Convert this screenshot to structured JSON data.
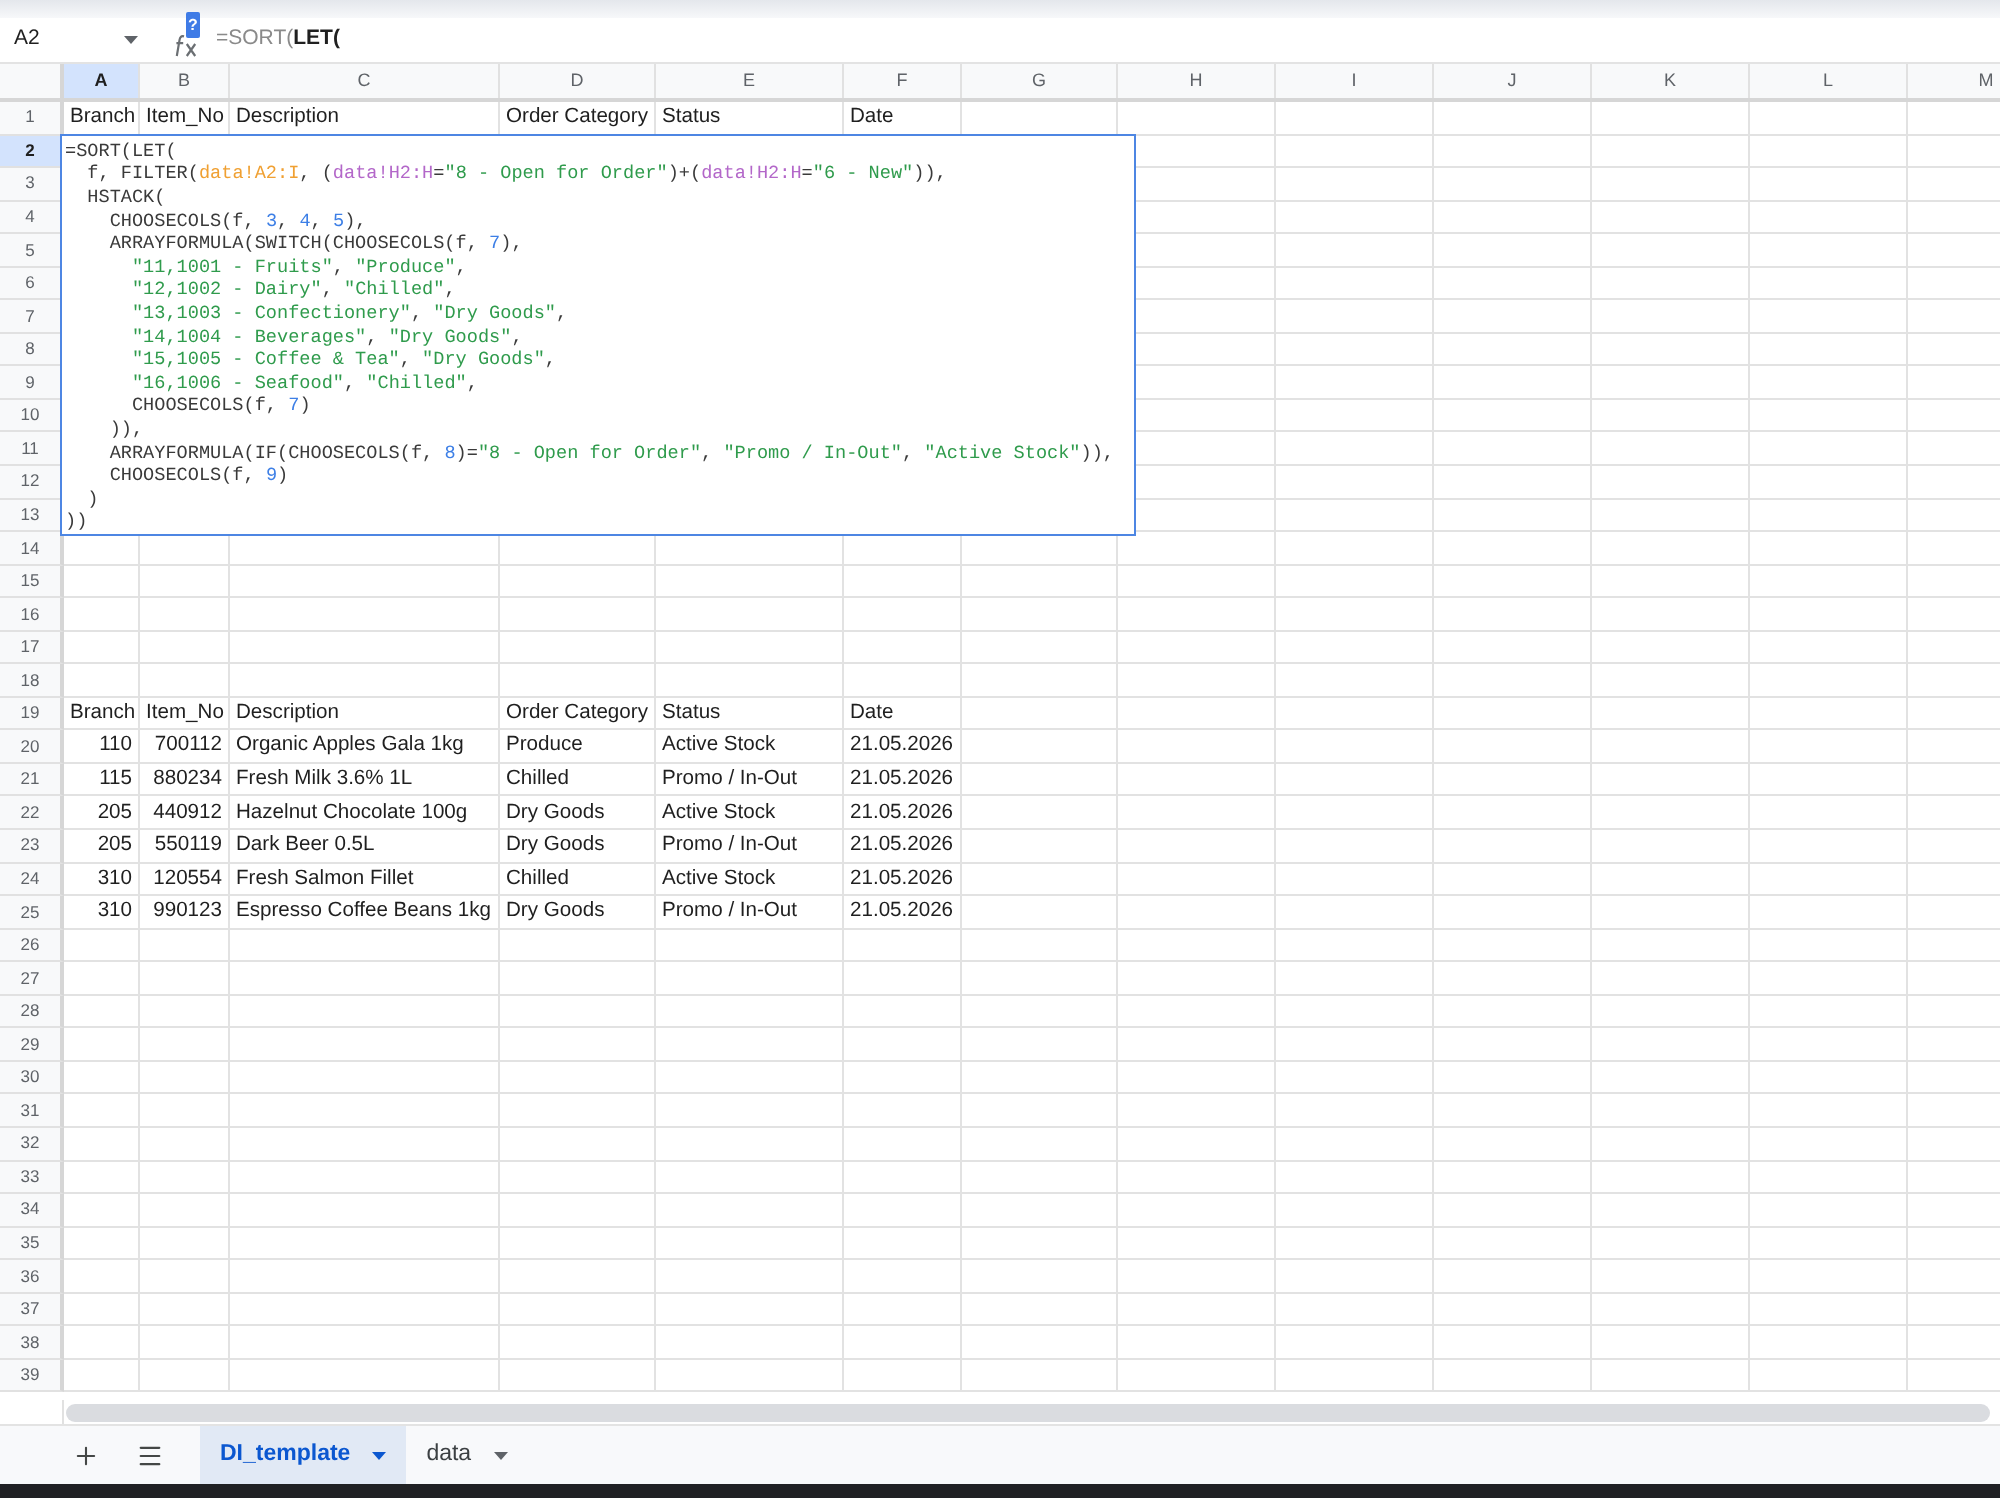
{
  "formula_bar": {
    "name_box": "A2",
    "help_badge": "?",
    "formula": "=SORT(**LET(**"
  },
  "columns": [
    {
      "label": "A",
      "selected": true
    },
    {
      "label": "B",
      "selected": false
    },
    {
      "label": "C",
      "selected": false
    },
    {
      "label": "D",
      "selected": false
    },
    {
      "label": "E",
      "selected": false
    },
    {
      "label": "F",
      "selected": false
    },
    {
      "label": "G",
      "selected": false
    },
    {
      "label": "H",
      "selected": false
    },
    {
      "label": "I",
      "selected": false
    },
    {
      "label": "J",
      "selected": false
    },
    {
      "label": "K",
      "selected": false
    },
    {
      "label": "L",
      "selected": false
    },
    {
      "label": "M",
      "selected": false
    }
  ],
  "rows": [
    {
      "number": "1",
      "selected": false,
      "cells": [
        {
          "text": "Branch",
          "kind": "text"
        },
        {
          "text": "Item_No",
          "kind": "text"
        },
        {
          "text": "Description",
          "kind": "text"
        },
        {
          "text": "Order Category",
          "kind": "text"
        },
        {
          "text": "Status",
          "kind": "text"
        },
        {
          "text": "Date",
          "kind": "text"
        }
      ]
    },
    {
      "number": "2",
      "selected": true
    },
    {
      "number": "3",
      "selected": false
    },
    {
      "number": "4",
      "selected": false
    },
    {
      "number": "5",
      "selected": false
    },
    {
      "number": "6",
      "selected": false
    },
    {
      "number": "7",
      "selected": false
    },
    {
      "number": "8",
      "selected": false
    },
    {
      "number": "9",
      "selected": false
    },
    {
      "number": "10",
      "selected": false
    },
    {
      "number": "11",
      "selected": false
    },
    {
      "number": "12",
      "selected": false
    },
    {
      "number": "13",
      "selected": false
    },
    {
      "number": "14",
      "selected": false
    },
    {
      "number": "15",
      "selected": false
    },
    {
      "number": "16",
      "selected": false
    },
    {
      "number": "17",
      "selected": false
    },
    {
      "number": "18",
      "selected": false
    },
    {
      "number": "19",
      "selected": false,
      "cells": [
        {
          "text": "Branch",
          "kind": "text"
        },
        {
          "text": "Item_No",
          "kind": "text"
        },
        {
          "text": "Description",
          "kind": "text"
        },
        {
          "text": "Order Category",
          "kind": "text"
        },
        {
          "text": "Status",
          "kind": "text"
        },
        {
          "text": "Date",
          "kind": "text"
        }
      ]
    },
    {
      "number": "20",
      "selected": false,
      "cells": [
        {
          "text": "110",
          "kind": "number"
        },
        {
          "text": "700112",
          "kind": "number"
        },
        {
          "text": "Organic Apples Gala 1kg",
          "kind": "text"
        },
        {
          "text": "Produce",
          "kind": "text"
        },
        {
          "text": "Active Stock",
          "kind": "text"
        },
        {
          "text": "21.05.2026",
          "kind": "text"
        }
      ]
    },
    {
      "number": "21",
      "selected": false,
      "cells": [
        {
          "text": "115",
          "kind": "number"
        },
        {
          "text": "880234",
          "kind": "number"
        },
        {
          "text": "Fresh Milk 3.6% 1L",
          "kind": "text"
        },
        {
          "text": "Chilled",
          "kind": "text"
        },
        {
          "text": "Promo / In-Out",
          "kind": "text"
        },
        {
          "text": "21.05.2026",
          "kind": "text"
        }
      ]
    },
    {
      "number": "22",
      "selected": false,
      "cells": [
        {
          "text": "205",
          "kind": "number"
        },
        {
          "text": "440912",
          "kind": "number"
        },
        {
          "text": "Hazelnut Chocolate 100g",
          "kind": "text"
        },
        {
          "text": "Dry Goods",
          "kind": "text"
        },
        {
          "text": "Active Stock",
          "kind": "text"
        },
        {
          "text": "21.05.2026",
          "kind": "text"
        }
      ]
    },
    {
      "number": "23",
      "selected": false,
      "cells": [
        {
          "text": "205",
          "kind": "number"
        },
        {
          "text": "550119",
          "kind": "number"
        },
        {
          "text": "Dark Beer 0.5L",
          "kind": "text"
        },
        {
          "text": "Dry Goods",
          "kind": "text"
        },
        {
          "text": "Promo / In-Out",
          "kind": "text"
        },
        {
          "text": "21.05.2026",
          "kind": "text"
        }
      ]
    },
    {
      "number": "24",
      "selected": false,
      "cells": [
        {
          "text": "310",
          "kind": "number"
        },
        {
          "text": "120554",
          "kind": "number"
        },
        {
          "text": "Fresh Salmon Fillet",
          "kind": "text"
        },
        {
          "text": "Chilled",
          "kind": "text"
        },
        {
          "text": "Active Stock",
          "kind": "text"
        },
        {
          "text": "21.05.2026",
          "kind": "text"
        }
      ]
    },
    {
      "number": "25",
      "selected": false,
      "cells": [
        {
          "text": "310",
          "kind": "number"
        },
        {
          "text": "990123",
          "kind": "number"
        },
        {
          "text": "Espresso Coffee Beans 1kg",
          "kind": "text"
        },
        {
          "text": "Dry Goods",
          "kind": "text"
        },
        {
          "text": "Promo / In-Out",
          "kind": "text"
        },
        {
          "text": "21.05.2026",
          "kind": "text"
        }
      ]
    },
    {
      "number": "26",
      "selected": false
    },
    {
      "number": "27",
      "selected": false
    },
    {
      "number": "28",
      "selected": false
    },
    {
      "number": "29",
      "selected": false
    },
    {
      "number": "30",
      "selected": false
    },
    {
      "number": "31",
      "selected": false
    },
    {
      "number": "32",
      "selected": false
    },
    {
      "number": "33",
      "selected": false
    },
    {
      "number": "34",
      "selected": false
    },
    {
      "number": "35",
      "selected": false
    },
    {
      "number": "36",
      "selected": false
    },
    {
      "number": "37",
      "selected": false
    },
    {
      "number": "38",
      "selected": false
    },
    {
      "number": "39",
      "selected": false
    }
  ],
  "formula_editor": {
    "lines": [
      [
        {
          "text": "=SORT(LET(",
          "kind": "plain"
        }
      ],
      [
        {
          "text": "  f, FILTER(",
          "kind": "plain"
        },
        {
          "text": "data!A2:I",
          "kind": "range",
          "color": "#f0a032"
        },
        {
          "text": ", (",
          "kind": "plain"
        },
        {
          "text": "data!H2:H",
          "kind": "range",
          "color": "#b367c9"
        },
        {
          "text": "=",
          "kind": "plain"
        },
        {
          "text": "\"8 - Open for Order\"",
          "kind": "string"
        },
        {
          "text": ")+(",
          "kind": "plain"
        },
        {
          "text": "data!H2:H",
          "kind": "range",
          "color": "#b367c9"
        },
        {
          "text": "=",
          "kind": "plain"
        },
        {
          "text": "\"6 - New\"",
          "kind": "string"
        },
        {
          "text": ")),",
          "kind": "plain"
        }
      ],
      [
        {
          "text": "  HSTACK(",
          "kind": "plain"
        }
      ],
      [
        {
          "text": "    CHOOSECOLS(f, ",
          "kind": "plain"
        },
        {
          "text": "3",
          "kind": "number"
        },
        {
          "text": ", ",
          "kind": "plain"
        },
        {
          "text": "4",
          "kind": "number"
        },
        {
          "text": ", ",
          "kind": "plain"
        },
        {
          "text": "5",
          "kind": "number"
        },
        {
          "text": "),",
          "kind": "plain"
        }
      ],
      [
        {
          "text": "    ARRAYFORMULA(SWITCH(CHOOSECOLS(f, ",
          "kind": "plain"
        },
        {
          "text": "7",
          "kind": "number"
        },
        {
          "text": "),",
          "kind": "plain"
        }
      ],
      [
        {
          "text": "      \"11,1001 - Fruits\"",
          "kind": "string"
        },
        {
          "text": ", ",
          "kind": "plain"
        },
        {
          "text": "\"Produce\"",
          "kind": "string"
        },
        {
          "text": ",",
          "kind": "plain"
        }
      ],
      [
        {
          "text": "      \"12,1002 - Dairy\"",
          "kind": "string"
        },
        {
          "text": ", ",
          "kind": "plain"
        },
        {
          "text": "\"Chilled\"",
          "kind": "string"
        },
        {
          "text": ",",
          "kind": "plain"
        }
      ],
      [
        {
          "text": "      \"13,1003 - Confectionery\"",
          "kind": "string"
        },
        {
          "text": ", ",
          "kind": "plain"
        },
        {
          "text": "\"Dry Goods\"",
          "kind": "string"
        },
        {
          "text": ",",
          "kind": "plain"
        }
      ],
      [
        {
          "text": "      \"14,1004 - Beverages\"",
          "kind": "string"
        },
        {
          "text": ", ",
          "kind": "plain"
        },
        {
          "text": "\"Dry Goods\"",
          "kind": "string"
        },
        {
          "text": ",",
          "kind": "plain"
        }
      ],
      [
        {
          "text": "      \"15,1005 - Coffee & Tea\"",
          "kind": "string"
        },
        {
          "text": ", ",
          "kind": "plain"
        },
        {
          "text": "\"Dry Goods\"",
          "kind": "string"
        },
        {
          "text": ",",
          "kind": "plain"
        }
      ],
      [
        {
          "text": "      \"16,1006 - Seafood\"",
          "kind": "string"
        },
        {
          "text": ", ",
          "kind": "plain"
        },
        {
          "text": "\"Chilled\"",
          "kind": "string"
        },
        {
          "text": ",",
          "kind": "plain"
        }
      ],
      [
        {
          "text": "      CHOOSECOLS(f, ",
          "kind": "plain"
        },
        {
          "text": "7",
          "kind": "number"
        },
        {
          "text": ")",
          "kind": "plain"
        }
      ],
      [
        {
          "text": "    )),",
          "kind": "plain"
        }
      ],
      [
        {
          "text": "    ARRAYFORMULA(IF(CHOOSECOLS(f, ",
          "kind": "plain"
        },
        {
          "text": "8",
          "kind": "number"
        },
        {
          "text": ")=",
          "kind": "plain"
        },
        {
          "text": "\"8 - Open for Order\"",
          "kind": "string"
        },
        {
          "text": ", ",
          "kind": "plain"
        },
        {
          "text": "\"Promo / In-Out\"",
          "kind": "string"
        },
        {
          "text": ", ",
          "kind": "plain"
        },
        {
          "text": "\"Active Stock\"",
          "kind": "string"
        },
        {
          "text": ")),",
          "kind": "plain"
        }
      ],
      [
        {
          "text": "    CHOOSECOLS(f, ",
          "kind": "plain"
        },
        {
          "text": "9",
          "kind": "number"
        },
        {
          "text": ")",
          "kind": "plain"
        }
      ],
      [
        {
          "text": "  )",
          "kind": "plain"
        }
      ],
      [
        {
          "text": "))",
          "kind": "plain"
        }
      ]
    ]
  },
  "sheet_tabs": [
    {
      "label": "DI_template",
      "selected": true
    },
    {
      "label": "data",
      "selected": false
    }
  ]
}
